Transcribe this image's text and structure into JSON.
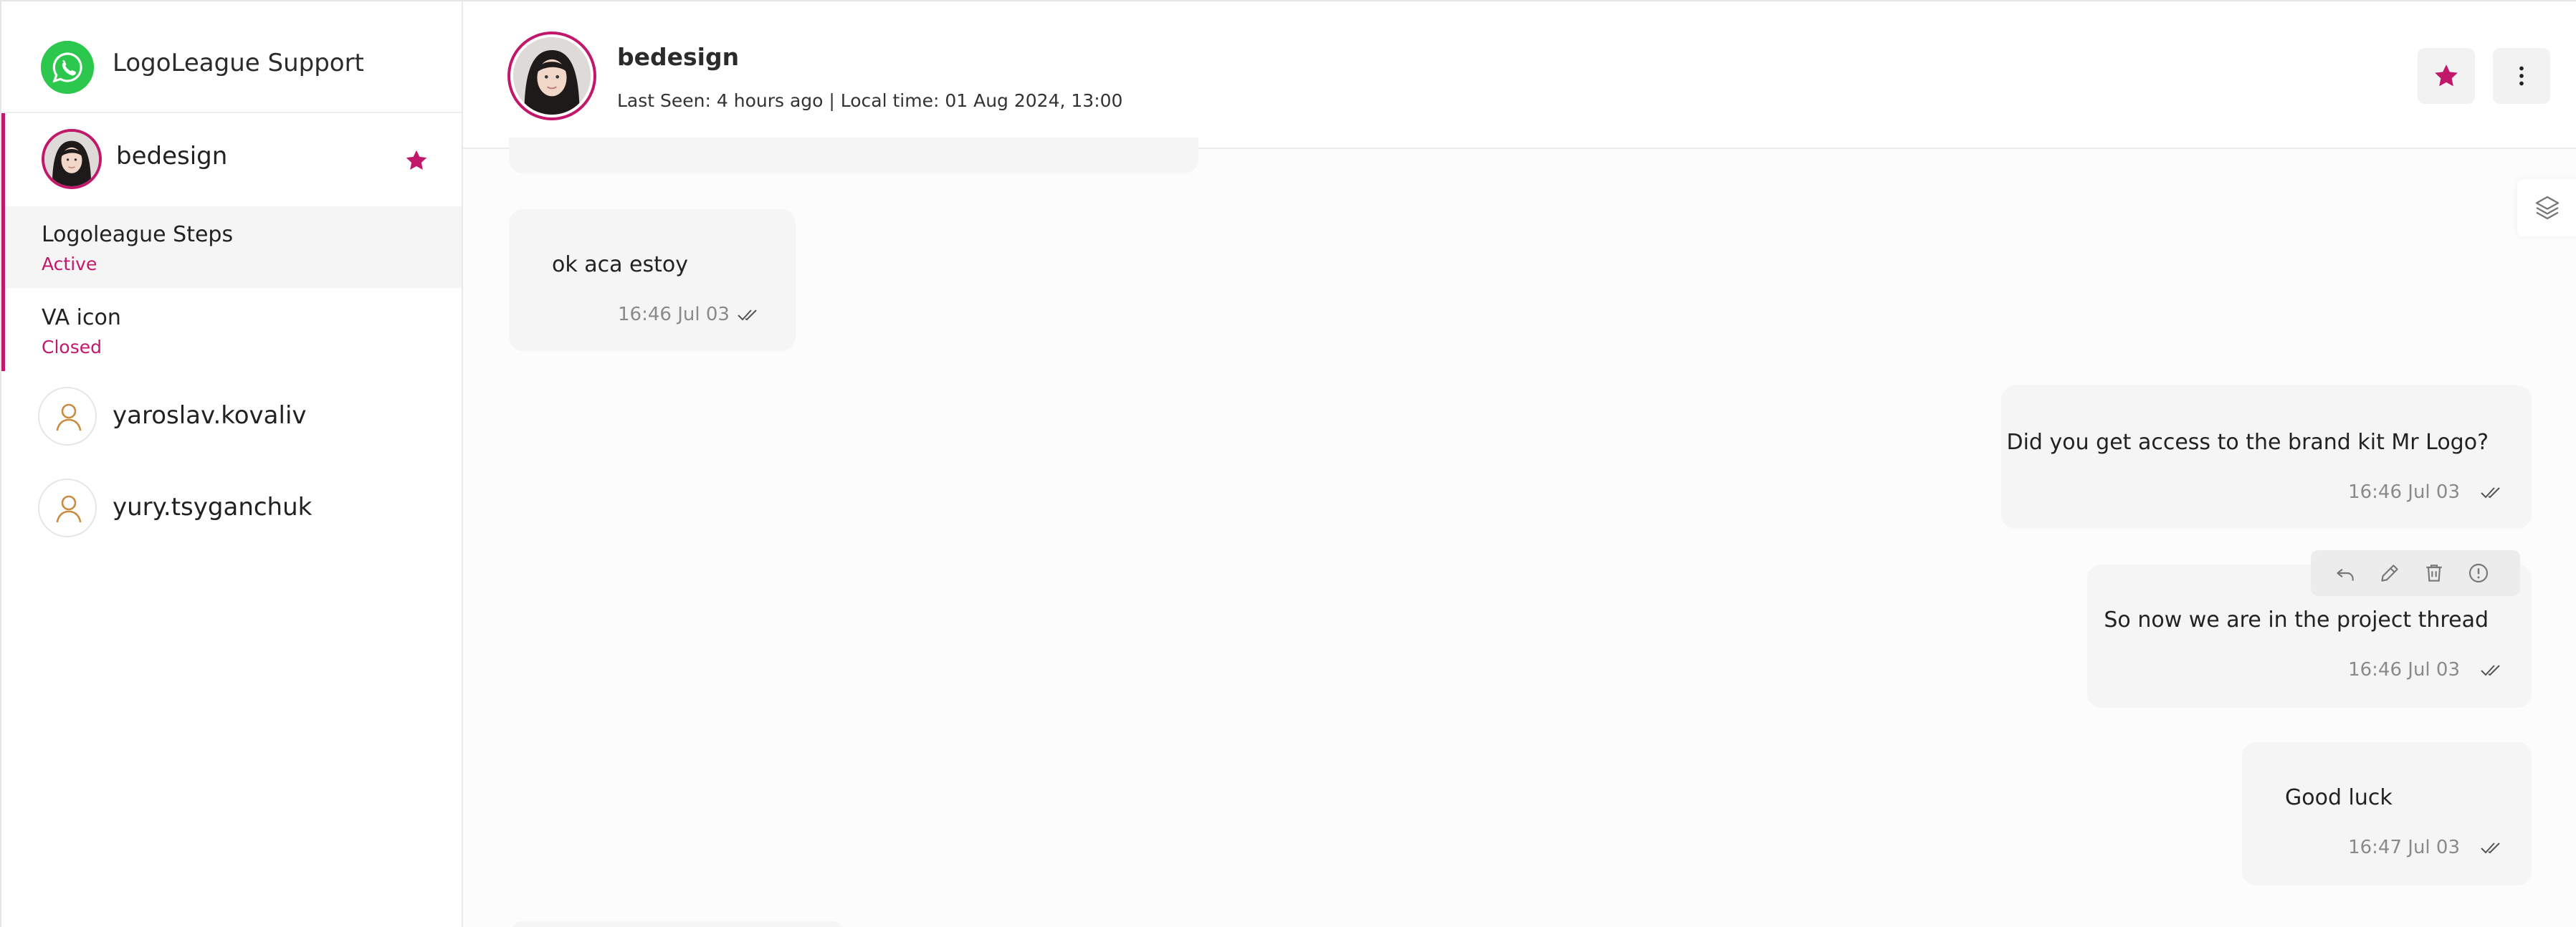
{
  "sidebar": {
    "app_title": "LogoLeague Support",
    "app_icon": "whatsapp-icon",
    "active_contact": {
      "name": "bedesign",
      "starred": true,
      "threads": [
        {
          "title": "Logoleague Steps",
          "status": "Active"
        },
        {
          "title": "VA icon",
          "status": "Closed"
        }
      ]
    },
    "contacts": [
      {
        "name": "yaroslav.kovaliv",
        "icon": "user-icon"
      },
      {
        "name": "yury.tsyganchuk",
        "icon": "user-icon"
      }
    ]
  },
  "header": {
    "name": "bedesign",
    "meta": "Last Seen: 4 hours ago | Local time: 01 Aug 2024, 13:00",
    "star_icon": "star-icon",
    "menu_icon": "more-vertical-icon"
  },
  "messages": [
    {
      "text": "ok aca estoy",
      "time": "16:46 Jul 03",
      "direction": "incoming"
    },
    {
      "text": "Did you get access to the brand kit Mr Logo?",
      "time": "16:46 Jul 03",
      "direction": "outgoing"
    },
    {
      "text": "So now we are in the project thread",
      "time": "16:46 Jul 03",
      "direction": "outgoing"
    },
    {
      "text": "Good luck",
      "time": "16:47 Jul 03",
      "direction": "outgoing"
    }
  ],
  "message_actions": [
    "reply-icon",
    "edit-icon",
    "delete-icon",
    "info-icon"
  ],
  "colors": {
    "accent": "#c2186b",
    "whatsapp": "#2cc84e",
    "bubble": "#f5f5f5",
    "background": "#fcfcfc"
  }
}
